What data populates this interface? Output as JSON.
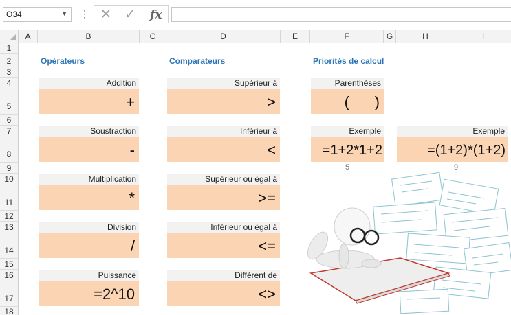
{
  "formula_bar": {
    "name_box": "O34",
    "more_icon": "⋮",
    "cancel_icon": "✕",
    "enter_icon": "✓",
    "fx_label": "fx",
    "formula": ""
  },
  "columns": [
    "A",
    "B",
    "C",
    "D",
    "E",
    "F",
    "G",
    "H",
    "I"
  ],
  "rows": [
    "1",
    "2",
    "3",
    "4",
    "5",
    "6",
    "7",
    "8",
    "9",
    "10",
    "11",
    "12",
    "13",
    "14",
    "15",
    "16",
    "17",
    "18"
  ],
  "sections": {
    "operateurs": "Opérateurs",
    "comparateurs": "Comparateurs",
    "priorites": "Priorités de calcul"
  },
  "operators": [
    {
      "label": "Addition",
      "symbol": "+"
    },
    {
      "label": "Soustraction",
      "symbol": "-"
    },
    {
      "label": "Multiplication",
      "symbol": "*"
    },
    {
      "label": "Division",
      "symbol": "/"
    },
    {
      "label": "Puissance",
      "symbol": "=2^10"
    }
  ],
  "comparators": [
    {
      "label": "Supérieur à",
      "symbol": ">"
    },
    {
      "label": "Inférieur à",
      "symbol": "<"
    },
    {
      "label": "Supérieur ou égal à",
      "symbol": ">="
    },
    {
      "label": "Inférieur ou égal à",
      "symbol": "<="
    },
    {
      "label": "Différent de",
      "symbol": "<>"
    }
  ],
  "priorities": {
    "parentheses_label": "Parenthèses",
    "parentheses_symbol": "(      )",
    "example1_label": "Exemple",
    "example1_formula": "=1+2*1+2",
    "example1_result": "5",
    "example2_label": "Exemple",
    "example2_formula": "=(1+2)*(1+2)",
    "example2_result": "9"
  },
  "colors": {
    "section_title": "#2e75b6",
    "value_fill": "#fbd4b4",
    "label_fill": "#f2f2f2"
  }
}
